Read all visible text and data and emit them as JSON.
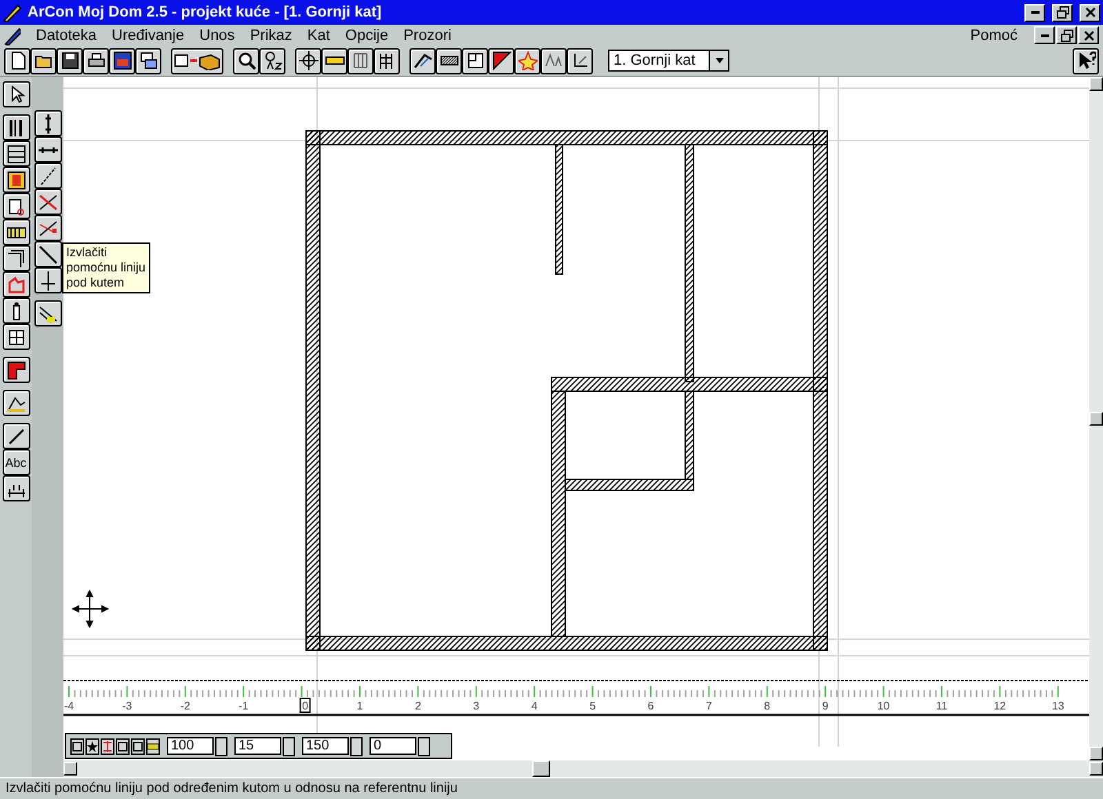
{
  "window": {
    "title": "ArCon Moj Dom  2.5 - projekt kuće - [1. Gornji kat]"
  },
  "menu": [
    "Datoteka",
    "Uređivanje",
    "Unos",
    "Prikaz",
    "Kat",
    "Opcije",
    "Prozori"
  ],
  "help_menu": "Pomoć",
  "floor_select": {
    "value": "1. Gornji kat"
  },
  "side_tools": {
    "text_tool": "Abc"
  },
  "tooltip": "Izvlačiti pomoćnu liniju pod kutem",
  "ruler": {
    "labels": [
      "-4",
      "-3",
      "-2",
      "-1",
      "0",
      "1",
      "2",
      "3",
      "4",
      "5",
      "6",
      "7",
      "8",
      "9",
      "10",
      "11",
      "12",
      "13"
    ]
  },
  "input_bar": {
    "fields": [
      "100",
      "15",
      "150",
      "0"
    ]
  },
  "status_bar": "Izvlačiti pomoćnu liniju pod određenim kutom u odnosu na referentnu liniju"
}
